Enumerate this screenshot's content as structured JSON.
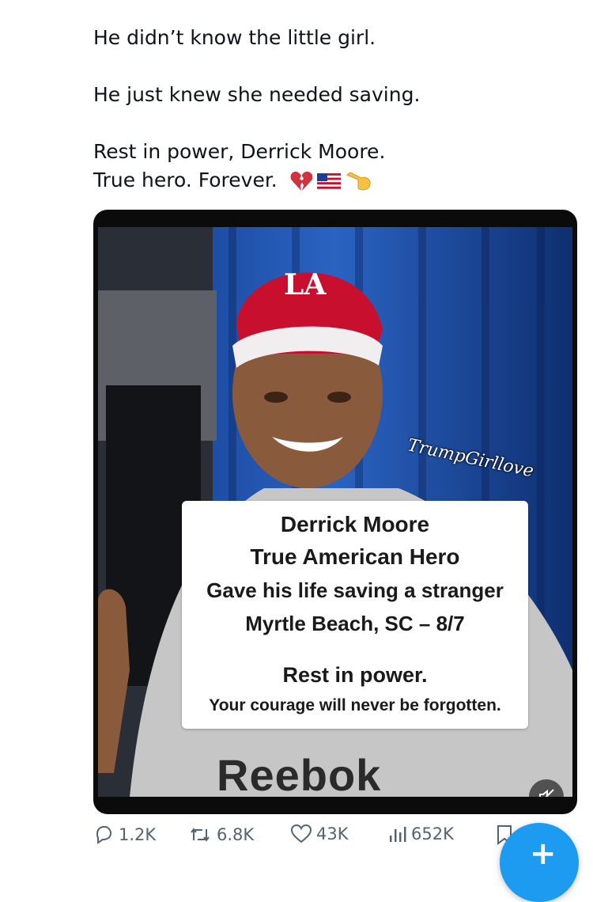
{
  "tweet": {
    "lines": [
      "He didn’t know the little girl.",
      "He just knew she needed saving.",
      "Rest in power, Derrick Moore.",
      "True hero. Forever."
    ],
    "emojis": [
      "broken-heart",
      "us-flag",
      "pointing-hand"
    ]
  },
  "media": {
    "watermark": "TrumpGirllove",
    "caption": {
      "name": "Derrick Moore",
      "title": "True American Hero",
      "line3": "Gave his life saving a stranger",
      "line4": "Myrtle Beach, SC – 8/7",
      "line5": "Rest in power.",
      "line6": "Your courage will never be forgotten."
    },
    "cap_logo": "LA",
    "shirt_brand": "Reebok"
  },
  "actions": {
    "replies": "1.2K",
    "reposts": "6.8K",
    "likes": "43K",
    "views": "652K"
  },
  "colors": {
    "accent": "#1d9bf0",
    "muted": "#536471",
    "broken_heart": "#d0333f"
  }
}
